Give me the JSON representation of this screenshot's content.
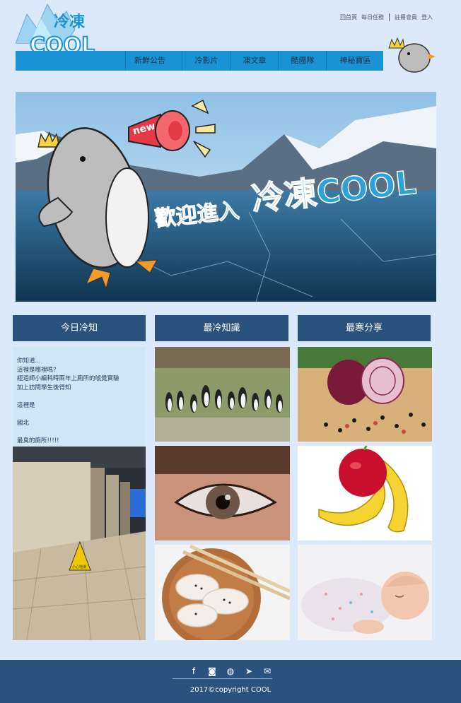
{
  "brand": {
    "logo_title": "冷凍",
    "logo_word": "COOL"
  },
  "top_links": [
    "回首頁",
    "每日任務",
    "註冊會員",
    "登入"
  ],
  "nav": [
    "新鮮公告",
    "冷影片",
    "凍文章",
    "酷團隊",
    "神秘寶區"
  ],
  "hero": {
    "badge": "new",
    "welcome": "歡迎進入",
    "brand": "冷凍COOL"
  },
  "columns": [
    "今日冷知",
    "最冷知識",
    "最寒分享"
  ],
  "trivia_text": "你知道...\n這裡是哪裡嗎?\n經過師小編耗時兩年上廁所的唬覺實驗\n加上訪問學生後得知\n\n這裡是\n\n國北\n\n最臭的廁所!!!!!",
  "sign_text": "小心地滑",
  "footer": {
    "icons": [
      "facebook-icon",
      "instagram-icon",
      "line-icon",
      "twitter-icon",
      "mail-icon"
    ],
    "copyright": "2017©copyright COOL"
  }
}
